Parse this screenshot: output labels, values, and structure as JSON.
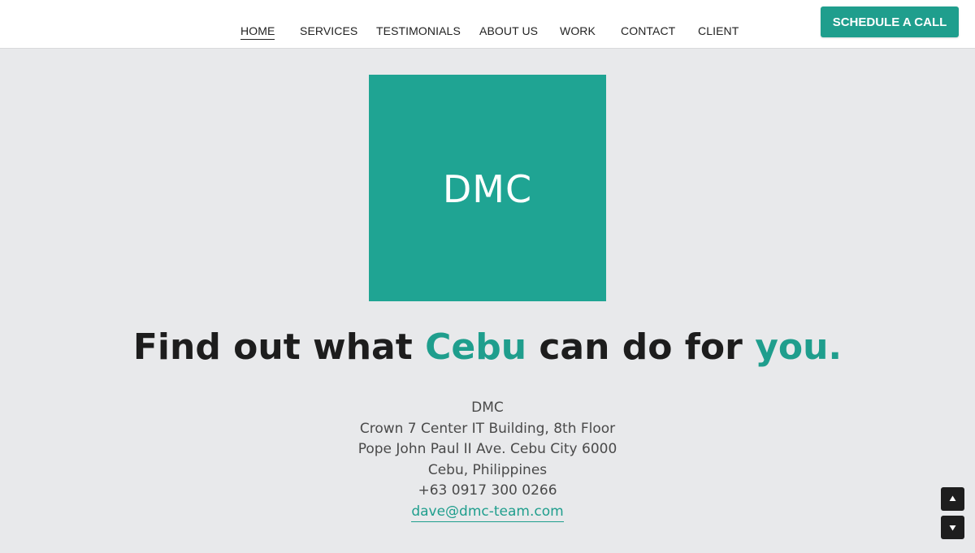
{
  "nav": {
    "items": [
      {
        "label": "HOME",
        "active": true
      },
      {
        "label": "SERVICES",
        "active": false
      },
      {
        "label": "TESTIMONIALS",
        "active": false
      },
      {
        "label": "ABOUT US",
        "active": false
      },
      {
        "label": "WORK",
        "active": false
      },
      {
        "label": "CONTACT",
        "active": false
      },
      {
        "label": "CLIENT",
        "active": false
      }
    ],
    "cta_label": "SCHEDULE A CALL"
  },
  "logo": {
    "text": "DMC"
  },
  "headline": {
    "part1": "Find out what ",
    "accent1": "Cebu",
    "part2": " can do for ",
    "accent2": "you."
  },
  "address": {
    "name": "DMC",
    "line1": "Crown 7 Center IT Building, 8th Floor",
    "line2": "Pope John Paul II Ave. Cebu City 6000",
    "line3": "Cebu, Philippines",
    "phone": "+63 0917 300 0266",
    "email": "dave@dmc-team.com"
  },
  "icons": {
    "scroll_up": "triangle-up-icon",
    "scroll_down": "triangle-down-icon"
  },
  "colors": {
    "accent": "#1f9e8d",
    "logo_bg": "#1fa493",
    "page_bg": "#e8e9eb",
    "dark": "#1d1d1d"
  }
}
